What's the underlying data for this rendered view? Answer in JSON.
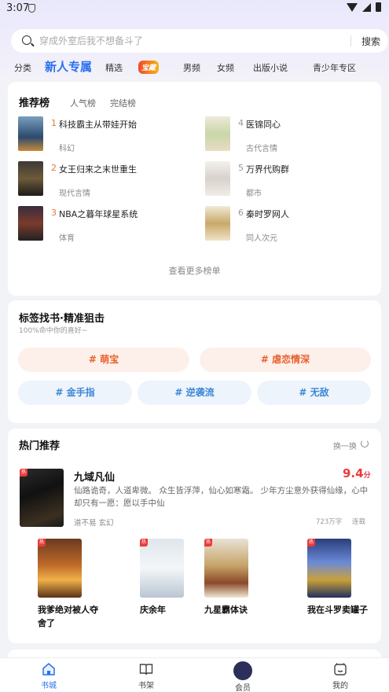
{
  "status_bar": {
    "time": "3:07"
  },
  "search": {
    "placeholder": "穿成外室后我不想备斗了",
    "button": "搜索"
  },
  "tabs": [
    "分类",
    "新人专属",
    "精选",
    "宝藏",
    "男频",
    "女频",
    "出版小说",
    "青少年专区"
  ],
  "ranking": {
    "tabs": [
      "推荐榜",
      "人气榜",
      "完结榜"
    ],
    "items": [
      {
        "rank": "1",
        "title": "科技霸主从带娃开始",
        "genre": "科幻"
      },
      {
        "rank": "2",
        "title": "女王归来之末世重生",
        "genre": "现代言情"
      },
      {
        "rank": "3",
        "title": "NBA之暮年球星系统",
        "genre": "体育"
      },
      {
        "rank": "4",
        "title": "医锦同心",
        "genre": "古代言情"
      },
      {
        "rank": "5",
        "title": "万界代购群",
        "genre": "都市"
      },
      {
        "rank": "6",
        "title": "秦时罗网人",
        "genre": "同人次元"
      }
    ],
    "more": "查看更多榜单"
  },
  "tag_search": {
    "title": "标签找书·精准狙击",
    "subtitle": "100%命中你的喜好~",
    "tags": [
      "# 萌宝",
      "# 虐恋情深",
      "# 金手指",
      "# 逆袭流",
      "# 无敌"
    ]
  },
  "hot": {
    "title": "热门推荐",
    "refresh": "换一换",
    "featured": {
      "title": "九域凡仙",
      "score": "9.4",
      "score_unit": "分",
      "desc": "仙路诡奇，人道卑微。 众生皆浮萍，仙心如寒霜。 少年方尘意外获得仙缘，心中却只有一愿：愿以手中仙",
      "author": "道不易 玄幻",
      "words": "723万字",
      "status": "连载"
    },
    "books": [
      {
        "title": "我爹绝对被人夺舍了"
      },
      {
        "title": "庆余年"
      },
      {
        "title": "九星霸体诀"
      },
      {
        "title": "我在斗罗卖罐子"
      }
    ],
    "badge": "热"
  },
  "nav": [
    "书城",
    "书架",
    "会员",
    "我的"
  ],
  "colors": {
    "accent": "#2a6ff0",
    "rank_number": "#e57a30",
    "score": "#ea3a3a"
  }
}
